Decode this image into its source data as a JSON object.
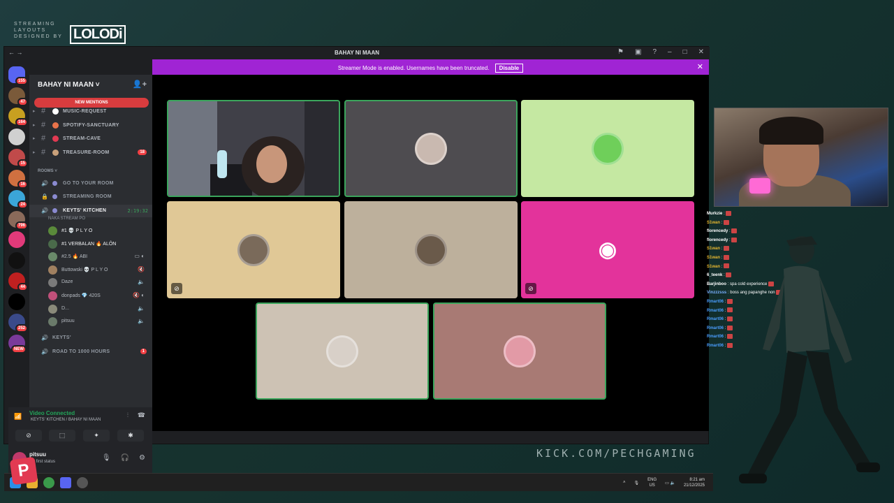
{
  "overlay": {
    "brand_line1": "STREAMING",
    "brand_line2": "LAYOUTS",
    "brand_line3": "DESIGNED BY",
    "brand_logo": "LOLODi",
    "kick_url": "KICK.COM/PECHGAMING"
  },
  "window": {
    "title": "BAHAY NI MAAN",
    "nav": "←  →"
  },
  "banner": {
    "message": "Streamer Mode is enabled. Usernames have been truncated.",
    "disable_label": "Disable",
    "close": "✕"
  },
  "rail": {
    "servers": [
      {
        "badge": "155",
        "color": "#5865f2"
      },
      {
        "badge": "47",
        "color": "#7a5a3a"
      },
      {
        "badge": "164",
        "color": "#c8a020"
      },
      {
        "badge": "",
        "color": "#d0d0d0"
      },
      {
        "badge": "15",
        "color": "#c04a4a"
      },
      {
        "badge": "16",
        "color": "#d07040"
      },
      {
        "badge": "24",
        "color": "#3ba5d8"
      },
      {
        "badge": "796",
        "color": "#8a6a5a"
      },
      {
        "badge": "",
        "color": "#e23a7a"
      },
      {
        "badge": "",
        "color": "#111111"
      },
      {
        "badge": "44",
        "color": "#c02020"
      },
      {
        "badge": "",
        "color": "#000000"
      },
      {
        "badge": "252",
        "color": "#3a4a8a"
      },
      {
        "badge": "NEW",
        "color": "#7a3a9a"
      }
    ]
  },
  "sidebar": {
    "server_name": "BAHAY NI MAAN ˅",
    "new_mentions": "NEW MENTIONS",
    "text_channels": [
      {
        "label": "MUSIC-REQUEST",
        "color": "#ffffff",
        "badge": ""
      },
      {
        "label": "SPOTIFY-SANCTUARY",
        "color": "#e8734a",
        "badge": ""
      },
      {
        "label": "STREAM-CAVE",
        "color": "#e23a52",
        "badge": ""
      },
      {
        "label": "TREASURE-ROOM",
        "color": "#c8a07a",
        "badge": "18"
      }
    ],
    "rooms_category": "ROOMS ˅",
    "voice_channels": [
      {
        "label": "GO TO YOUR ROOM"
      },
      {
        "label": "STREAMING ROOM"
      },
      {
        "label": "KEYTS' KITCHEN",
        "timer": "2:19:32",
        "subtitle": "NAKA STREAM PO"
      }
    ],
    "members": [
      {
        "name": "#1 💀 P L Y O",
        "color": "#5a8a3a",
        "right": ""
      },
      {
        "name": "#1 VERBALAN 🔥 ALÔN",
        "color": "#4a6a4a",
        "right": ""
      },
      {
        "name": "#2.5 🔥 ABI",
        "color": "#6a8a6a",
        "right": "▭ ◐"
      },
      {
        "name": "Buttowski 💀 P L Y O",
        "color": "#a08060",
        "right": "🔇"
      },
      {
        "name": "Daze",
        "color": "#7a7a7a",
        "right": "🔈"
      },
      {
        "name": "donpads 💎 420S",
        "color": "#c0507a",
        "right": "🔇 ◐"
      },
      {
        "name": "D...",
        "color": "#8a8a7a",
        "right": "🔈"
      },
      {
        "name": "pitsuu",
        "color": "#6a7a6a",
        "right": "🔈"
      }
    ],
    "extra_channels": [
      {
        "label": "KEYTS'"
      },
      {
        "label": "ROAD TO 1000 HOURS",
        "badge": "1"
      }
    ]
  },
  "voice_panel": {
    "status": "Video Connected",
    "path": "KEYTS' KITCHEN / BAHAY NI MAAN",
    "buttons": [
      "⊘",
      "⬚",
      "✦",
      "✱"
    ]
  },
  "user_panel": {
    "name": "pitsuu",
    "status": "my first status",
    "controls": [
      "🎙",
      "🎧",
      "⚙"
    ]
  },
  "tiles": [
    {
      "bg": "#3a3a3a",
      "avatar": "",
      "speaking": true,
      "muted": false
    },
    {
      "bg": "#4e4c50",
      "avatar": "#c9b9b0",
      "speaking": true,
      "muted": false
    },
    {
      "bg": "#c5e8a2",
      "avatar": "#6fcf5a",
      "speaking": false,
      "muted": false
    },
    {
      "bg": "#e0c896",
      "avatar": "#7a6a5a",
      "speaking": false,
      "muted": true
    },
    {
      "bg": "#bdb09c",
      "avatar": "#6a5a4a",
      "speaking": false,
      "muted": false
    },
    {
      "bg": "#e3339b",
      "avatar": "discord",
      "speaking": false,
      "muted": true
    },
    {
      "bg": "#cdc2b4",
      "avatar": "#d8d0c8",
      "speaking": true,
      "muted": false
    },
    {
      "bg": "#a87a74",
      "avatar": "#e29aa6",
      "speaking": true,
      "muted": false
    }
  ],
  "taskbar": {
    "lang": "ENG",
    "region": "US",
    "time": "8:21 am",
    "date": "21/12/2025"
  },
  "chat": [
    {
      "user": "Murkzie",
      "color": "#ffffff",
      "text": ":"
    },
    {
      "user": "S1wan",
      "color": "#e8b830",
      "text": ":"
    },
    {
      "user": "florencedy",
      "color": "#ffffff",
      "text": ":"
    },
    {
      "user": "florencedy",
      "color": "#ffffff",
      "text": ":"
    },
    {
      "user": "S1wan",
      "color": "#e8b830",
      "text": ":"
    },
    {
      "user": "S1wan",
      "color": "#e8b830",
      "text": ":"
    },
    {
      "user": "S1wan",
      "color": "#e8b830",
      "text": ":"
    },
    {
      "user": "6_teenk",
      "color": "#ffffff",
      "text": ":"
    },
    {
      "user": "Barjinboo",
      "color": "#ffffff",
      "text": ": spa cold experience"
    },
    {
      "user": "Vinzzzsss",
      "color": "#7ab0ff",
      "text": ": boss ang papanghe non"
    },
    {
      "user": "Rmart06",
      "color": "#4a9eff",
      "text": ":"
    },
    {
      "user": "Rmart06",
      "color": "#4a9eff",
      "text": ":"
    },
    {
      "user": "Rmart06",
      "color": "#4a9eff",
      "text": ":"
    },
    {
      "user": "Rmart06",
      "color": "#4a9eff",
      "text": ":"
    },
    {
      "user": "Rmart06",
      "color": "#4a9eff",
      "text": ":"
    },
    {
      "user": "Rmart06",
      "color": "#4a9eff",
      "text": ":"
    }
  ]
}
